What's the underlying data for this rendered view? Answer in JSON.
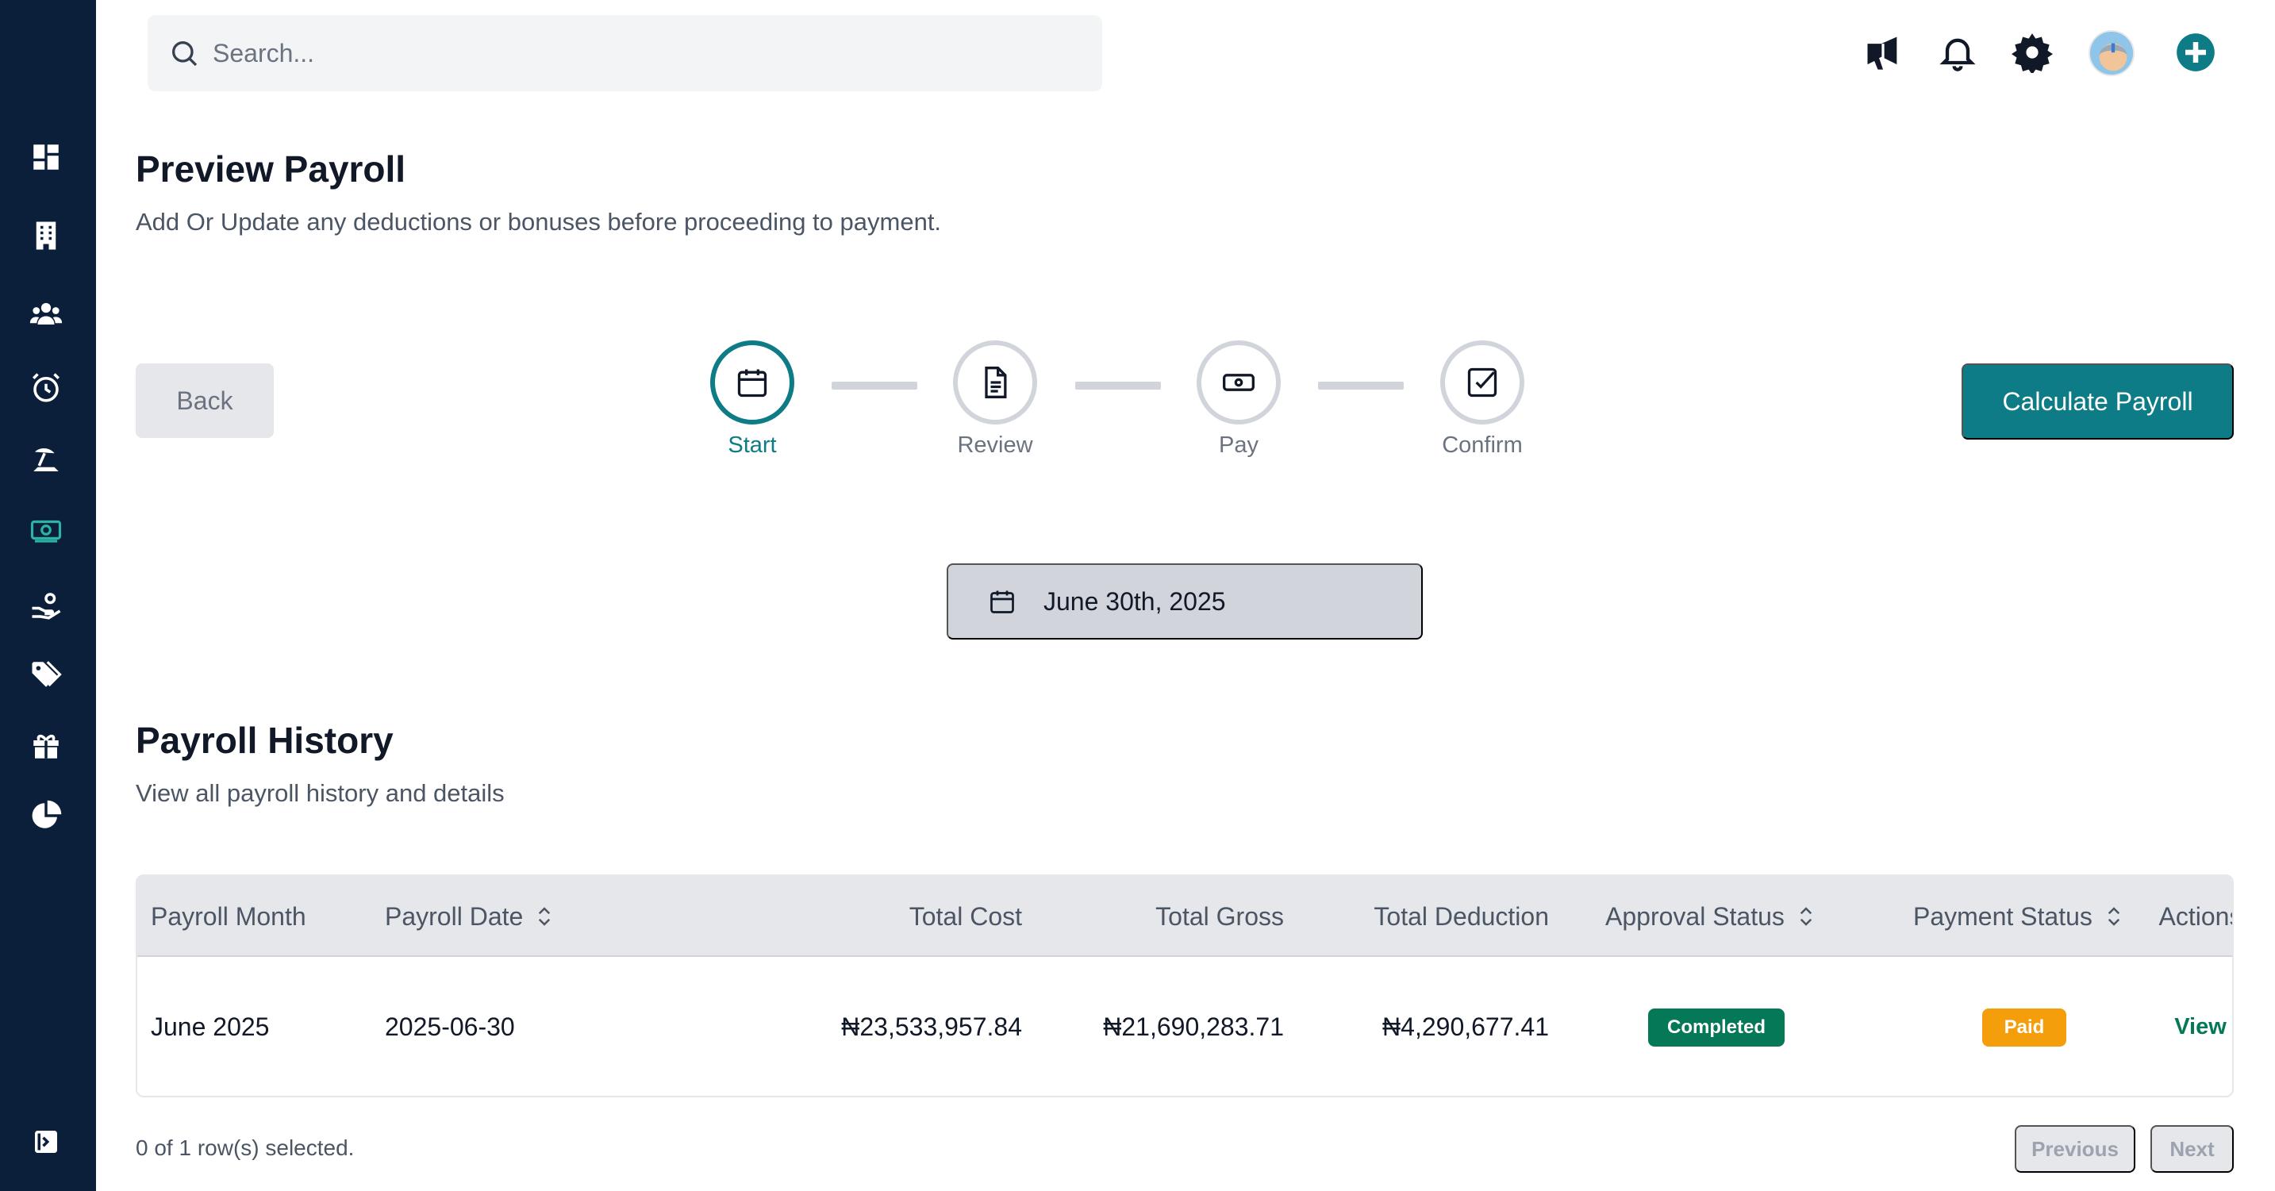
{
  "colors": {
    "sidebar_bg": "#0b1f3a",
    "accent": "#0e7c86",
    "completed_badge": "#047857",
    "paid_badge": "#f59e0b"
  },
  "sidebar": {
    "items": [
      {
        "icon": "dashboard-icon"
      },
      {
        "icon": "building-icon"
      },
      {
        "icon": "users-icon"
      },
      {
        "icon": "alarm-clock-icon"
      },
      {
        "icon": "beach-umbrella-icon"
      },
      {
        "icon": "money-bill-icon",
        "active": true
      },
      {
        "icon": "hand-holding-icon"
      },
      {
        "icon": "tags-icon"
      },
      {
        "icon": "gift-icon"
      },
      {
        "icon": "pie-chart-icon"
      }
    ],
    "toggle_icon": "sidebar-toggle-icon"
  },
  "search": {
    "placeholder": "Search..."
  },
  "topbar": {
    "icons": [
      "megaphone-icon",
      "bell-icon",
      "gear-icon",
      "avatar",
      "plus-circle-icon"
    ]
  },
  "preview": {
    "title": "Preview Payroll",
    "subtitle": "Add Or Update any deductions or bonuses before proceeding to payment.",
    "back_label": "Back",
    "calculate_label": "Calculate Payroll",
    "steps": [
      {
        "label": "Start",
        "icon": "calendar-icon",
        "active": true
      },
      {
        "label": "Review",
        "icon": "document-icon",
        "active": false
      },
      {
        "label": "Pay",
        "icon": "cash-icon",
        "active": false
      },
      {
        "label": "Confirm",
        "icon": "checkbox-icon",
        "active": false
      }
    ],
    "date_label": "June 30th, 2025"
  },
  "history": {
    "title": "Payroll History",
    "subtitle": "View all payroll history and details",
    "columns": [
      "Payroll Month",
      "Payroll Date",
      "Total Cost",
      "Total Gross",
      "Total Deduction",
      "Approval Status",
      "Payment Status",
      "Actions"
    ],
    "rows": [
      {
        "month": "June 2025",
        "date": "2025-06-30",
        "total_cost": "₦23,533,957.84",
        "total_gross": "₦21,690,283.71",
        "total_deduction": "₦4,290,677.41",
        "approval_status": "Completed",
        "payment_status": "Paid",
        "action": "View"
      }
    ],
    "selection_text": "0 of 1 row(s) selected.",
    "previous_label": "Previous",
    "next_label": "Next"
  }
}
